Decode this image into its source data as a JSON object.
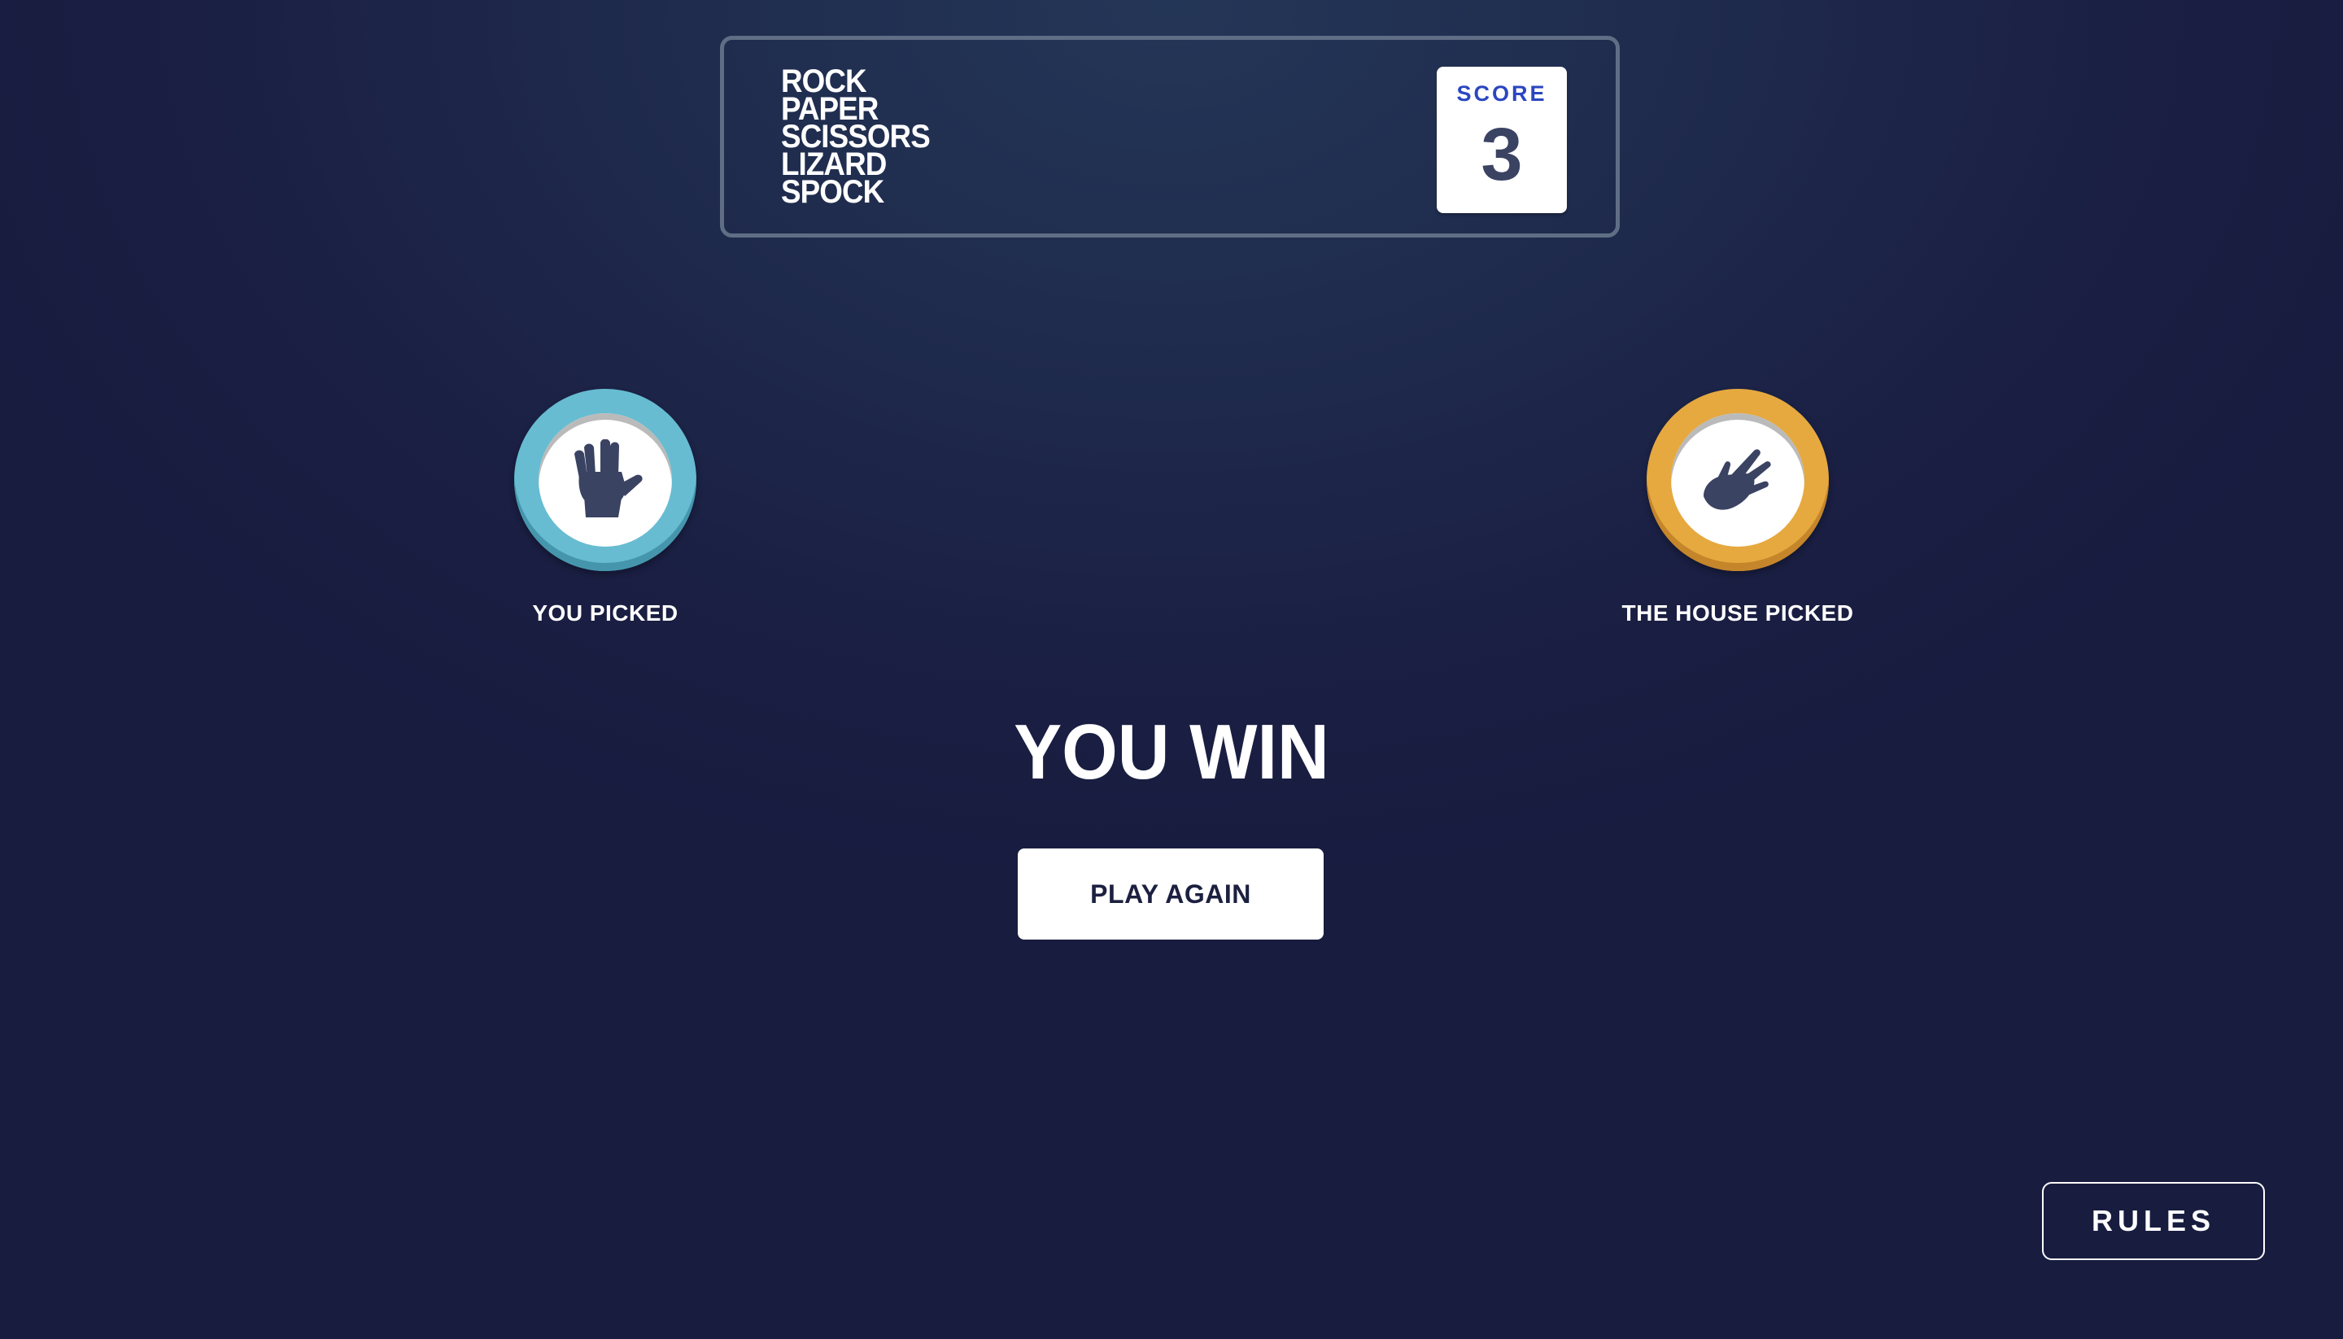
{
  "header": {
    "title_lines": [
      "ROCK",
      "PAPER",
      "SCISSORS",
      "LIZARD",
      "SPOCK"
    ],
    "score_label": "SCORE",
    "score_value": "3"
  },
  "picks": {
    "you": {
      "label": "YOU PICKED",
      "choice": "spock",
      "icon": "spock-hand-icon",
      "ring_color": "#67bcd1"
    },
    "house": {
      "label": "THE HOUSE PICKED",
      "choice": "lizard",
      "icon": "lizard-hand-icon",
      "ring_color": "#e6a93f"
    }
  },
  "result": {
    "text": "YOU WIN",
    "play_again_label": "PLAY AGAIN"
  },
  "rules_label": "RULES",
  "colors": {
    "score_label": "#2a46c0",
    "score_value": "#3b4363",
    "icon": "#3b4363"
  }
}
